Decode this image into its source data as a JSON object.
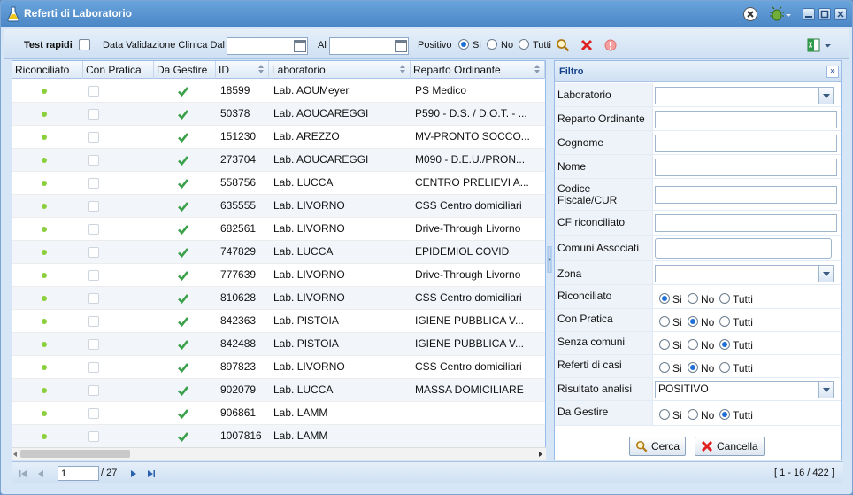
{
  "window": {
    "title": "Referti di Laboratorio"
  },
  "toolbar": {
    "test_rapidi_label": "Test rapidi",
    "data_validazione_label": "Data Validazione Clinica Dal",
    "al_label": "Al",
    "positivo_label": "Positivo",
    "positivo_options": [
      "Si",
      "No",
      "Tutti"
    ],
    "positivo_selected": "Si",
    "date_from": "",
    "date_to": ""
  },
  "grid": {
    "columns": [
      "Riconciliato",
      "Con Pratica",
      "Da Gestire",
      "ID",
      "Laboratorio",
      "Reparto Ordinante"
    ],
    "rows": [
      {
        "id": "18599",
        "lab": "Lab. AOUMeyer",
        "reparto": "PS Medico"
      },
      {
        "id": "50378",
        "lab": "Lab. AOUCAREGGI",
        "reparto": "P590 - D.S. / D.O.T. - ..."
      },
      {
        "id": "151230",
        "lab": "Lab. AREZZO",
        "reparto": "MV-PRONTO SOCCO..."
      },
      {
        "id": "273704",
        "lab": "Lab. AOUCAREGGI",
        "reparto": "M090 - D.E.U./PRON..."
      },
      {
        "id": "558756",
        "lab": "Lab. LUCCA",
        "reparto": "CENTRO PRELIEVI A..."
      },
      {
        "id": "635555",
        "lab": "Lab. LIVORNO",
        "reparto": "CSS Centro domiciliari"
      },
      {
        "id": "682561",
        "lab": "Lab. LIVORNO",
        "reparto": "Drive-Through Livorno"
      },
      {
        "id": "747829",
        "lab": "Lab. LUCCA",
        "reparto": "EPIDEMIOL COVID"
      },
      {
        "id": "777639",
        "lab": "Lab. LIVORNO",
        "reparto": "Drive-Through Livorno"
      },
      {
        "id": "810628",
        "lab": "Lab. LIVORNO",
        "reparto": "CSS Centro domiciliari"
      },
      {
        "id": "842363",
        "lab": "Lab. PISTOIA",
        "reparto": "IGIENE PUBBLICA V..."
      },
      {
        "id": "842488",
        "lab": "Lab. PISTOIA",
        "reparto": "IGIENE PUBBLICA V..."
      },
      {
        "id": "897823",
        "lab": "Lab. LIVORNO",
        "reparto": "CSS Centro domiciliari"
      },
      {
        "id": "902079",
        "lab": "Lab. LUCCA",
        "reparto": "MASSA DOMICILIARE"
      },
      {
        "id": "906861",
        "lab": "Lab. LAMM",
        "reparto": ""
      },
      {
        "id": "1007816",
        "lab": "Lab. LAMM",
        "reparto": ""
      }
    ]
  },
  "filter": {
    "title": "Filtro",
    "laboratorio_label": "Laboratorio",
    "reparto_label": "Reparto Ordinante",
    "cognome_label": "Cognome",
    "nome_label": "Nome",
    "codice_fiscale_label": "Codice Fiscale/CUR",
    "cf_riconciliato_label": "CF riconciliato",
    "comuni_label": "Comuni Associati",
    "zona_label": "Zona",
    "riconciliato_label": "Riconciliato",
    "con_pratica_label": "Con Pratica",
    "senza_comuni_label": "Senza comuni",
    "referti_casi_label": "Referti di casi",
    "risultato_label": "Risultato analisi",
    "risultato_value": "POSITIVO",
    "da_gestire_label": "Da Gestire",
    "radio_si": "Si",
    "radio_no": "No",
    "radio_tutti": "Tutti",
    "cerca_label": "Cerca",
    "cancella_label": "Cancella"
  },
  "paging": {
    "page": "1",
    "of_total": "/ 27",
    "summary": "[ 1 - 16 / 422 ]"
  },
  "colors": {
    "accent": "#4a86c6",
    "title_text": "#15428b",
    "status_dot": "#8ccf3c",
    "check": "#3aa04a"
  }
}
